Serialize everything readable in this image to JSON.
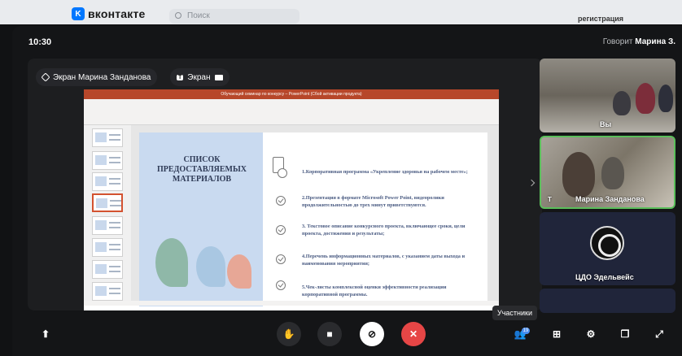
{
  "vk": {
    "logo_mark": "K",
    "logo_text": "вконтакте",
    "search_placeholder": "Поиск",
    "register": "регистрация"
  },
  "call": {
    "time": "10:30",
    "speaking_label": "Говорит",
    "speaking_name": "Марина З."
  },
  "stage": {
    "pinned_label": "Экран Марина Занданова",
    "screen_label": "Экран",
    "screen_badge": "T"
  },
  "presentation": {
    "window_title": "Обучающий семинар по конкурсу – PowerPoint (Сбой активации продукта)",
    "slide_title": "СПИСОК ПРЕДОСТАВЛЯЕМЫХ МАТЕРИАЛОВ",
    "items": [
      "1.Корпоративная программа «Укрепление здоровья на рабочем месте»;",
      "2.Презентация в формате Microsoft Power Point, видеоролики продолжительностью до трех минут приветствуются.",
      "3. Текстовое описание конкурсного проекта, включающее сроки, цели проекта, достижения и результаты;",
      "4.Перечень информационных материалов, с указанием даты выхода и наименования мероприятия;",
      "5.Чек-листы комплексной оценки эффективности реализации корпоративной программы."
    ]
  },
  "participants": [
    {
      "name": "Вы"
    },
    {
      "name": "Марина Занданова",
      "badge": "T"
    },
    {
      "name": "ЦДО Эдельвейс"
    },
    {
      "name": ""
    }
  ],
  "tooltip": "Участники",
  "controls": {
    "participants_count": "19"
  },
  "colors": {
    "end_call": "#e64646",
    "active_speaker_border": "#5bbf5b",
    "ppt_accent": "#b7472a",
    "vk_blue": "#0077ff"
  }
}
